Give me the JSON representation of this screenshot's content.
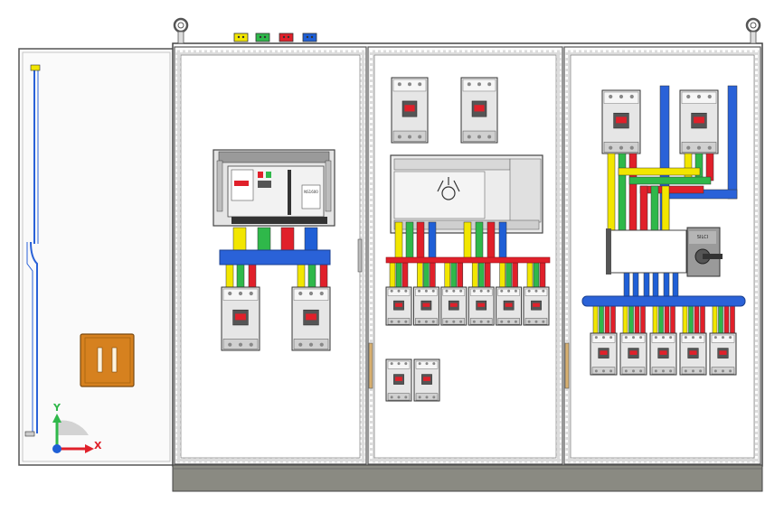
{
  "axis_triad": {
    "y_label": "Y",
    "x_label": "X"
  },
  "colors": {
    "phase_l1": "#f2e600",
    "phase_l2": "#2fb84a",
    "phase_l3": "#e0202a",
    "neutral": "#1f5fd6",
    "busbar_blue": "#2a62d8",
    "door_handle": "#d6811f",
    "cabinet_line": "#6a6a6a",
    "plinth": "#8a8a82"
  },
  "labels": {
    "main_breaker_model": "NS1600",
    "changeover_switch": "SILCI"
  },
  "counts": {
    "middle_outgoing_breakers": 6,
    "right_outgoing_breakers": 5
  },
  "icons": [
    "lifting-eye-icon",
    "phase-marker-icon",
    "axis-triad-icon"
  ]
}
